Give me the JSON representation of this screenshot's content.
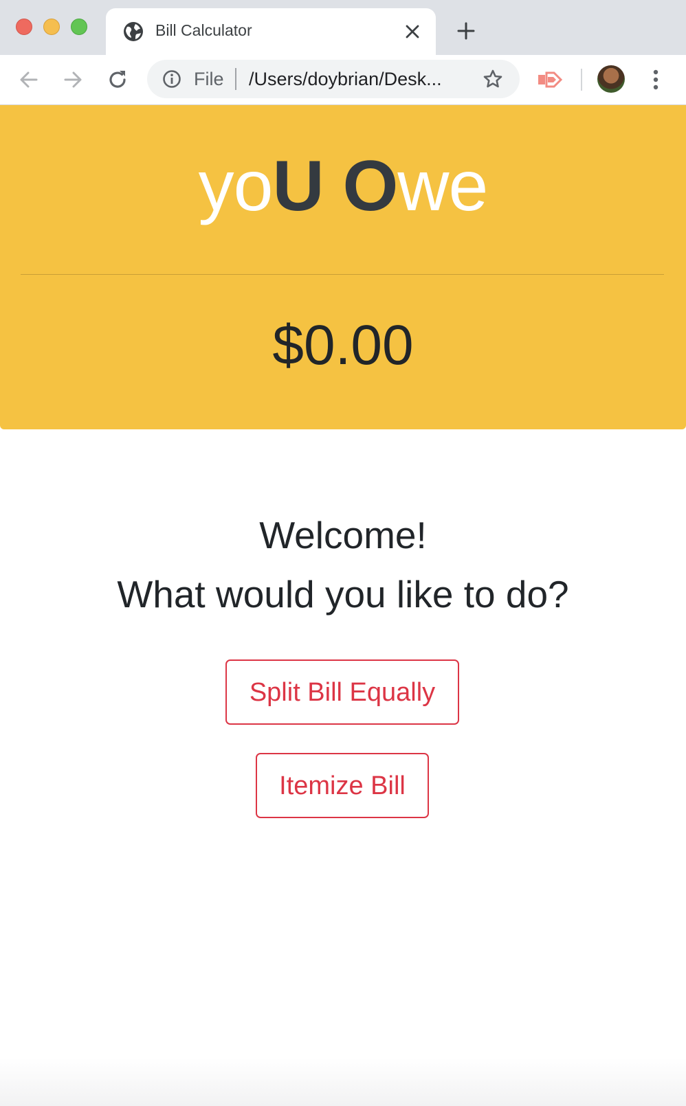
{
  "browser": {
    "tab": {
      "title": "Bill Calculator"
    },
    "omnibox": {
      "scheme": "File",
      "url": "/Users/doybrian/Desk..."
    },
    "icons": {
      "back": "arrow-left-icon",
      "forward": "arrow-right-icon",
      "reload": "reload-icon",
      "info": "info-icon",
      "bookmark": "star-icon",
      "extension": "cast-extension-icon",
      "menu": "kebab-menu-icon"
    }
  },
  "header": {
    "brand": {
      "part1": "yo",
      "part2": "U",
      "part3": " ",
      "part4": "O",
      "part5": "we"
    },
    "amount": "$0.00"
  },
  "main": {
    "welcome": "Welcome!",
    "question": "What would you like to do?",
    "actions": {
      "split": "Split Bill Equally",
      "itemize": "Itemize Bill"
    }
  },
  "colors": {
    "hero_bg": "#f5c242",
    "danger": "#dc3545",
    "dark": "#343a40"
  }
}
